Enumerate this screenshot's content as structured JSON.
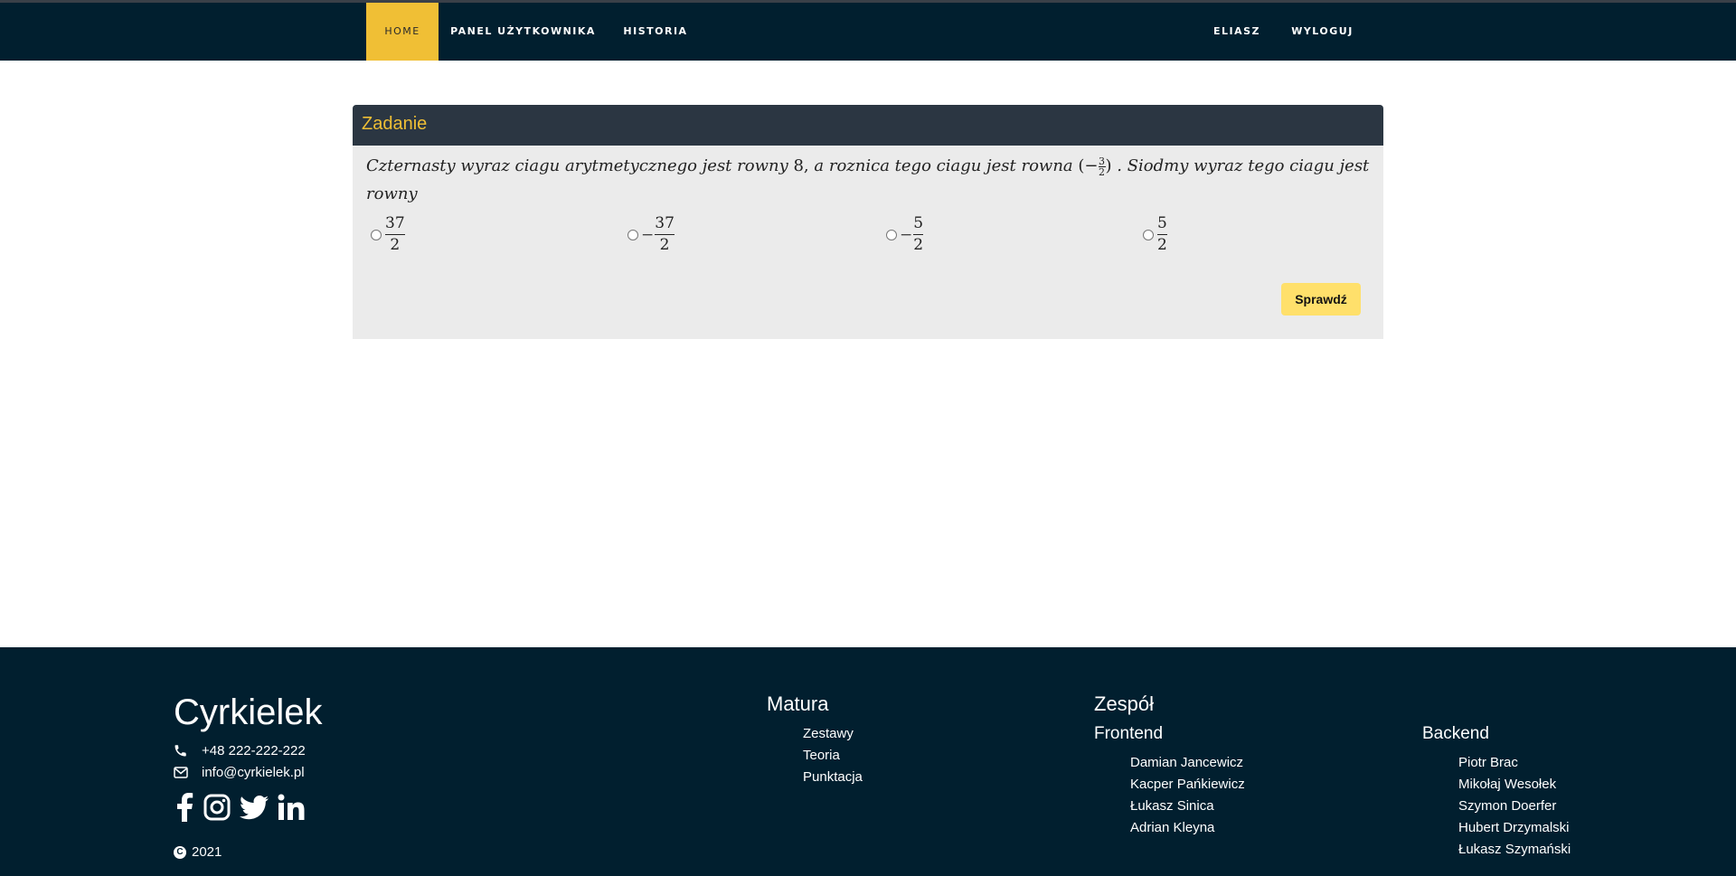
{
  "nav": {
    "left": [
      {
        "label": "HOME",
        "active": true
      },
      {
        "label": "PANEL UŻYTKOWNIKA",
        "active": false
      },
      {
        "label": "HISTORIA",
        "active": false
      }
    ],
    "right": [
      {
        "label": "ELIASZ"
      },
      {
        "label": "WYLOGUJ"
      }
    ]
  },
  "task": {
    "title": "Zadanie",
    "question_part1": "Czternasty wyraz ciagu arytmetycznego jest rowny",
    "question_num": "8,",
    "question_part2": "a roznica tego ciagu jest rowna",
    "question_diff_sign": "−",
    "question_diff_num": "3",
    "question_diff_den": "2",
    "question_part3": ". Siodmy wyraz tego ciagu jest rowny",
    "options": [
      {
        "sign": "",
        "num": "37",
        "den": "2"
      },
      {
        "sign": "−",
        "num": "37",
        "den": "2"
      },
      {
        "sign": "−",
        "num": "5",
        "den": "2"
      },
      {
        "sign": "",
        "num": "5",
        "den": "2"
      }
    ],
    "submit_label": "Sprawdź"
  },
  "footer": {
    "brand": "Cyrkielek",
    "phone": "+48 222-222-222",
    "email": "info@cyrkielek.pl",
    "social_icons": [
      "facebook-icon",
      "instagram-icon",
      "twitter-icon",
      "linkedin-icon"
    ],
    "copyright": "2021",
    "matura": {
      "title": "Matura",
      "items": [
        "Zestawy",
        "Teoria",
        "Punktacja"
      ]
    },
    "team": {
      "title": "Zespół",
      "frontend": {
        "title": "Frontend",
        "members": [
          "Damian Jancewicz",
          "Kacper Pańkiewicz",
          "Łukasz Sinica",
          "Adrian Kleyna"
        ]
      },
      "backend": {
        "title": "Backend",
        "members": [
          "Piotr Brac",
          "Mikołaj Wesołek",
          "Szymon Doerfer",
          "Hubert Drzymalski",
          "Łukasz Szymański"
        ]
      }
    }
  },
  "colors": {
    "nav_bg": "#011f2f",
    "accent": "#f0bf35",
    "card_header": "#2b3642",
    "button": "#ffe06b"
  }
}
